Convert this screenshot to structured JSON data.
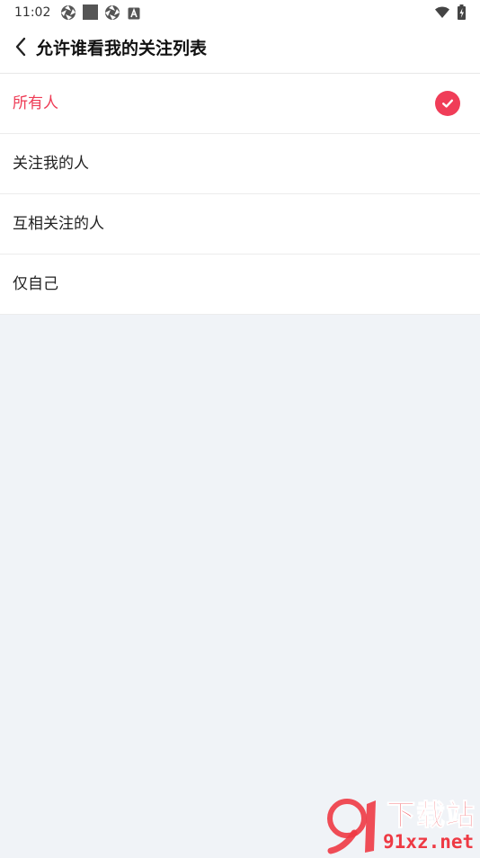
{
  "status_bar": {
    "time": "11:02",
    "left_icons": [
      "aperture-icon",
      "square-icon",
      "aperture-icon",
      "a-badge-icon"
    ],
    "right_icons": [
      "wifi-icon",
      "battery-charging-icon"
    ]
  },
  "header": {
    "back_icon": "chevron-left-icon",
    "title": "允许谁看我的关注列表"
  },
  "options": [
    {
      "label": "所有人",
      "selected": true
    },
    {
      "label": "关注我的人",
      "selected": false
    },
    {
      "label": "互相关注的人",
      "selected": false
    },
    {
      "label": "仅自己",
      "selected": false
    }
  ],
  "colors": {
    "accent": "#f03d58",
    "background": "#f0f3f7",
    "watermark": "#ee3a44"
  },
  "watermark": {
    "logo_text": "91",
    "brand": "下载站",
    "url": "91xz.net"
  }
}
